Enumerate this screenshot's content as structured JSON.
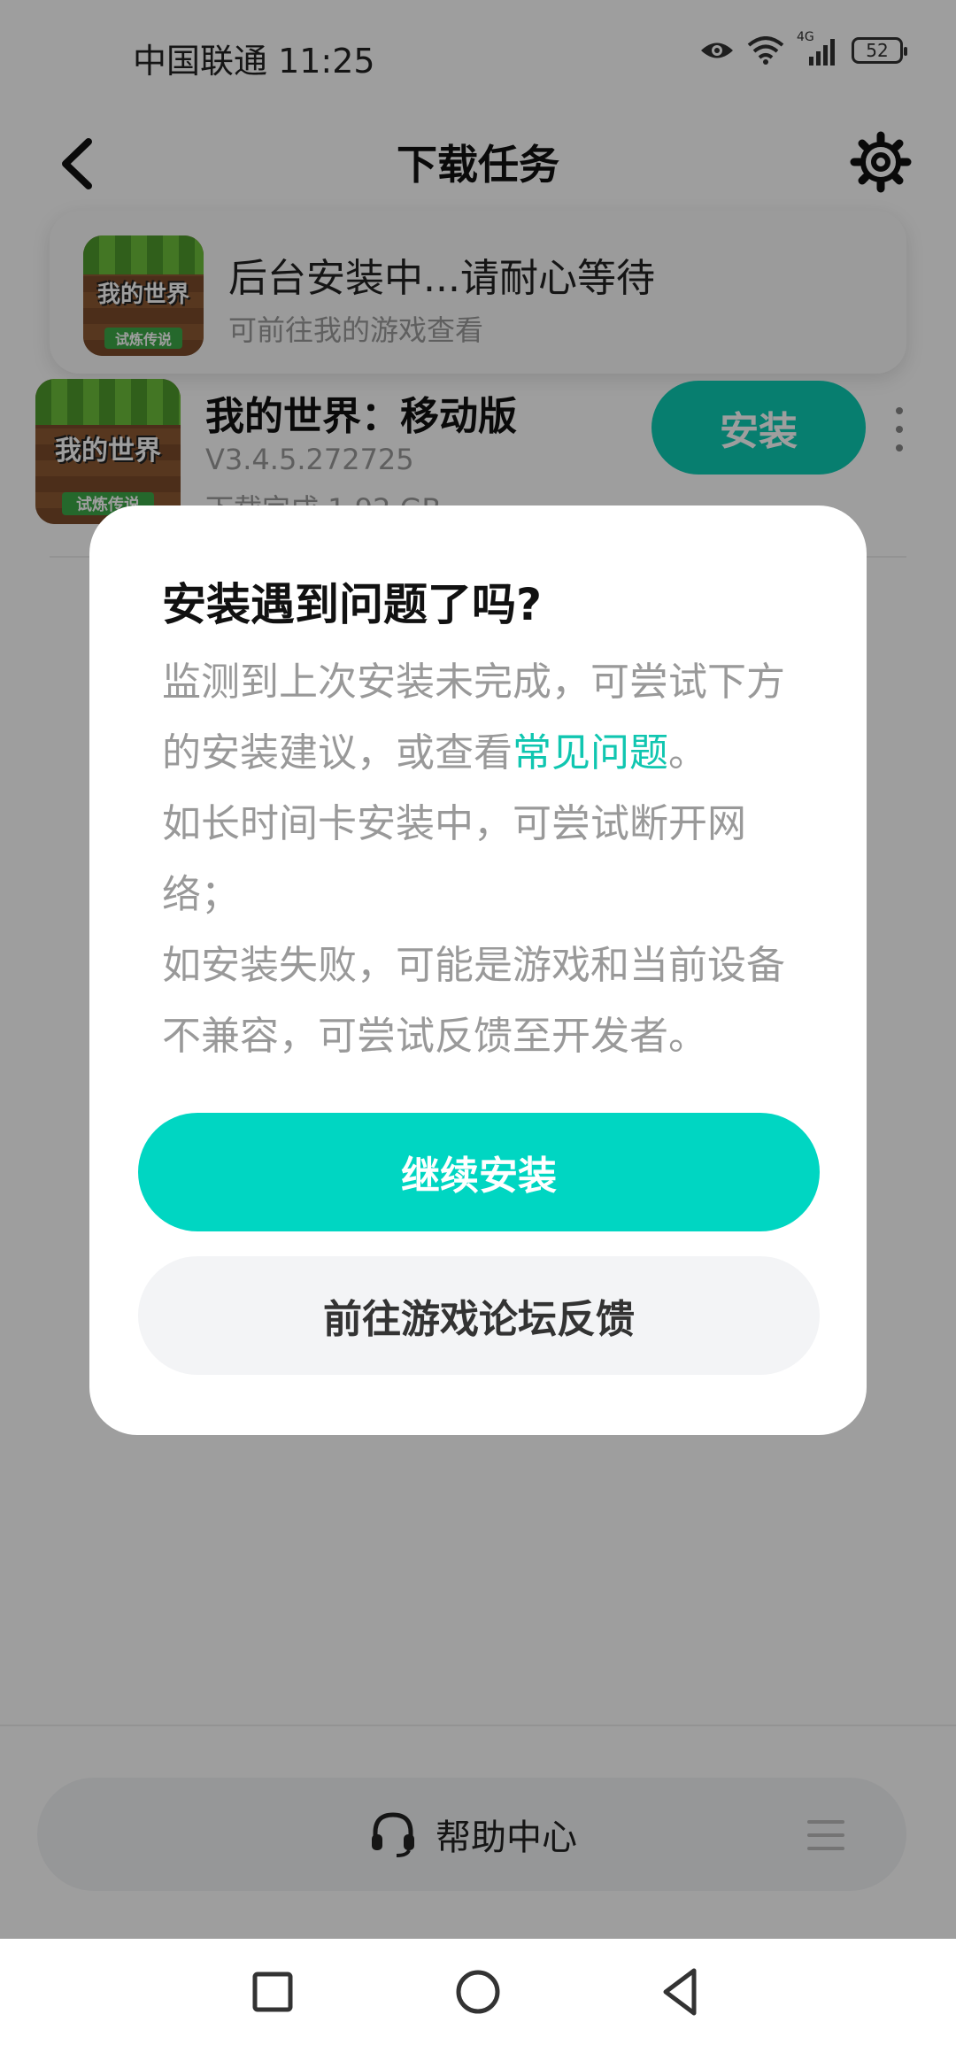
{
  "status_bar": {
    "carrier_time": "中国联通 11:25",
    "network": "4G",
    "battery": "52"
  },
  "header": {
    "title": "下载任务",
    "back_icon": "chevron-left-icon",
    "settings_icon": "gear-icon"
  },
  "banner": {
    "title": "后台安装中...请耐心等待",
    "subtitle": "可前往我的游戏查看"
  },
  "game_icon": {
    "logo_text": "我的世界",
    "tag_text": "试炼传说"
  },
  "download_item": {
    "name": "我的世界：移动版",
    "version": "V3.4.5.272725",
    "status": "下载完成 1.92 GB",
    "install_label": "安装"
  },
  "dialog": {
    "title": "安装遇到问题了吗?",
    "body_part1": "监测到上次安装未完成，可尝试下方的安装建议，或查看",
    "faq_link": "常见问题",
    "body_part2": "。",
    "body_line2": "如长时间卡安装中，可尝试断开网络；",
    "body_line3": "如安装失败，可能是游戏和当前设备不兼容，可尝试反馈至开发者。",
    "primary_label": "继续安装",
    "secondary_label": "前往游戏论坛反馈"
  },
  "help": {
    "label": "帮助中心"
  },
  "colors": {
    "accent": "#00d6c2",
    "install_button": "#0ccbb4",
    "link": "#10c6b0",
    "overlay": "rgba(0,0,0,0.38)"
  }
}
